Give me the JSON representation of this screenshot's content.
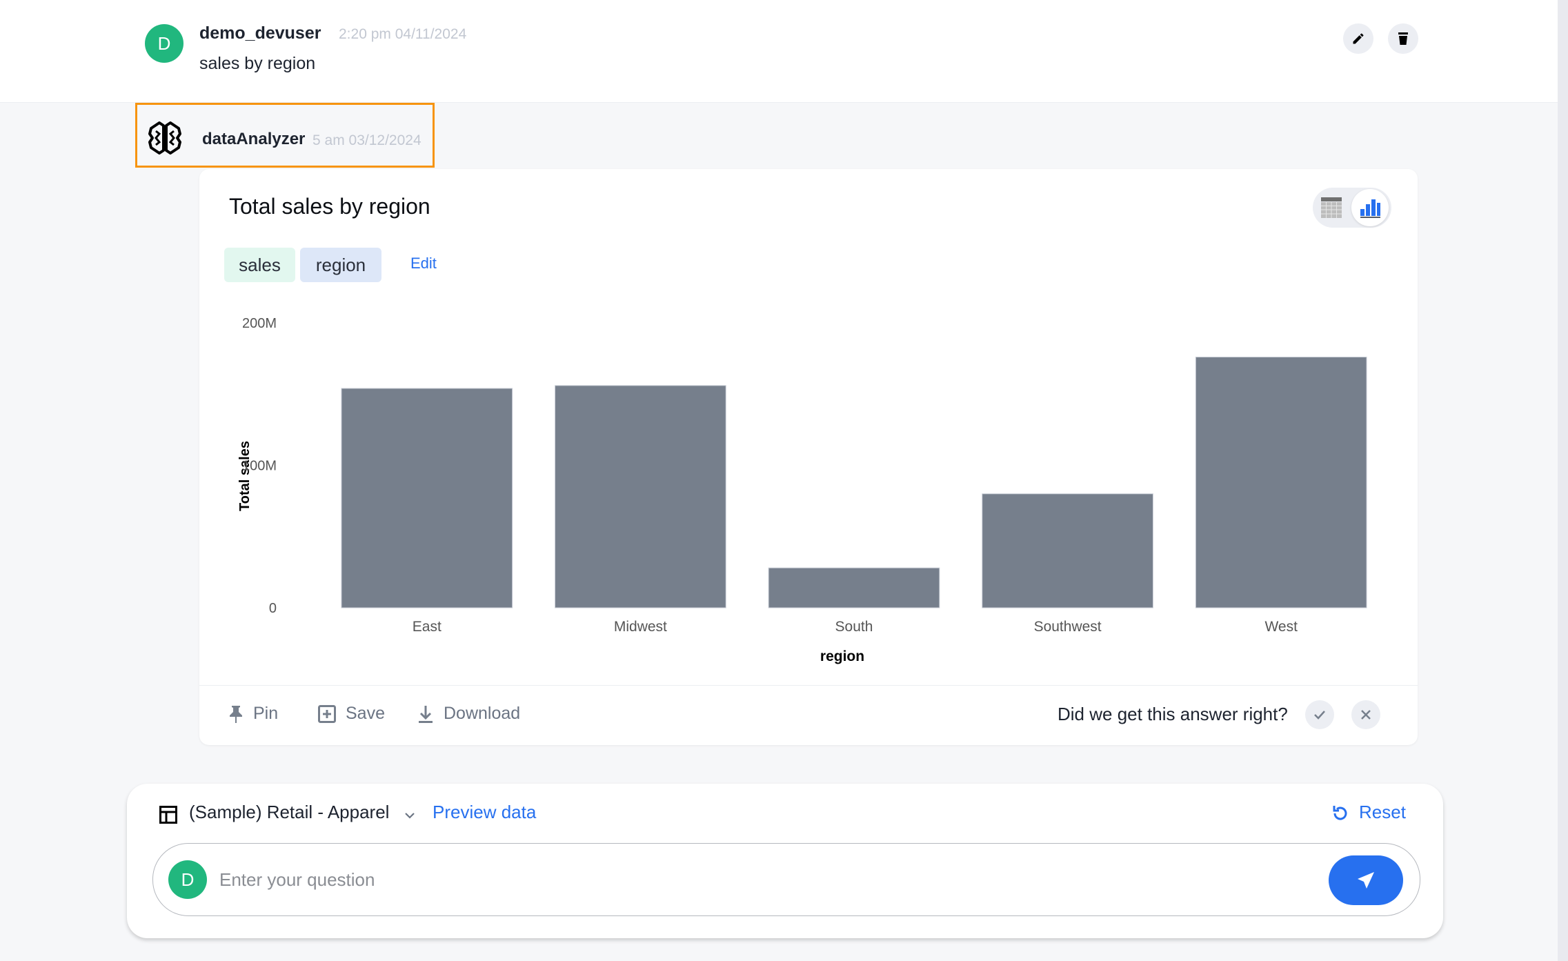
{
  "user_message": {
    "avatar_initial": "D",
    "username": "demo_devuser",
    "timestamp": "2:20 pm 04/11/2024",
    "text": "sales by region",
    "actions": [
      "edit",
      "delete"
    ]
  },
  "bot_message": {
    "name": "dataAnalyzer",
    "timestamp": "5 am 03/12/2024",
    "highlight_color": "#f7940f"
  },
  "answer_card": {
    "title": "Total sales by region",
    "view_toggle": {
      "options": [
        "table",
        "chart"
      ],
      "selected": "chart"
    },
    "chips": [
      {
        "label": "sales",
        "kind": "measure",
        "color": "#e2f7ef"
      },
      {
        "label": "region",
        "kind": "attribute",
        "color": "#dde7f8"
      }
    ],
    "edit_label": "Edit",
    "footer": {
      "pin_label": "Pin",
      "save_label": "Save",
      "download_label": "Download",
      "feedback_question": "Did we get this answer right?"
    }
  },
  "chart_data": {
    "type": "bar",
    "title": "Total sales by region",
    "xlabel": "region",
    "ylabel": "Total sales",
    "categories": [
      "East",
      "Midwest",
      "South",
      "Southwest",
      "West"
    ],
    "values": [
      154000000,
      156000000,
      28000000,
      80000000,
      176000000
    ],
    "ylim": [
      0,
      200000000
    ],
    "yticks": [
      0,
      100000000,
      200000000
    ],
    "ytick_labels": [
      "0",
      "100M",
      "200M"
    ],
    "grid": false,
    "bar_color": "#767f8c"
  },
  "input_panel": {
    "datasource": "(Sample) Retail - Apparel",
    "preview_label": "Preview data",
    "reset_label": "Reset",
    "avatar_initial": "D",
    "placeholder": "Enter your question",
    "value": ""
  },
  "colors": {
    "accent": "#2770ef",
    "avatar": "#21b77e"
  }
}
